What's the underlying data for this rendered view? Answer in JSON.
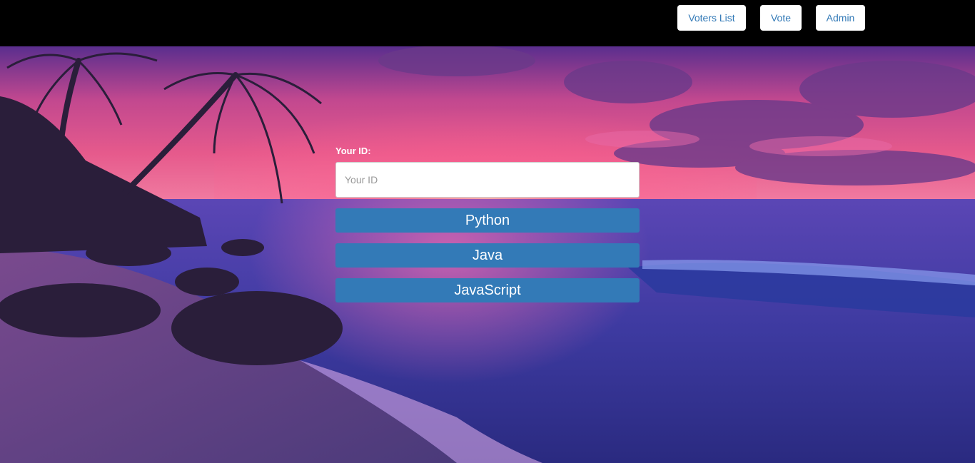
{
  "nav": {
    "voters_list": "Voters List",
    "vote": "Vote",
    "admin": "Admin"
  },
  "form": {
    "id_label": "Your ID:",
    "id_placeholder": "Your ID",
    "id_value": ""
  },
  "choices": [
    "Python",
    "Java",
    "JavaScript"
  ],
  "colors": {
    "topbar": "#000000",
    "nav_text": "#337ab7",
    "choice_button": "#337ab7",
    "choice_text": "#ffffff"
  }
}
